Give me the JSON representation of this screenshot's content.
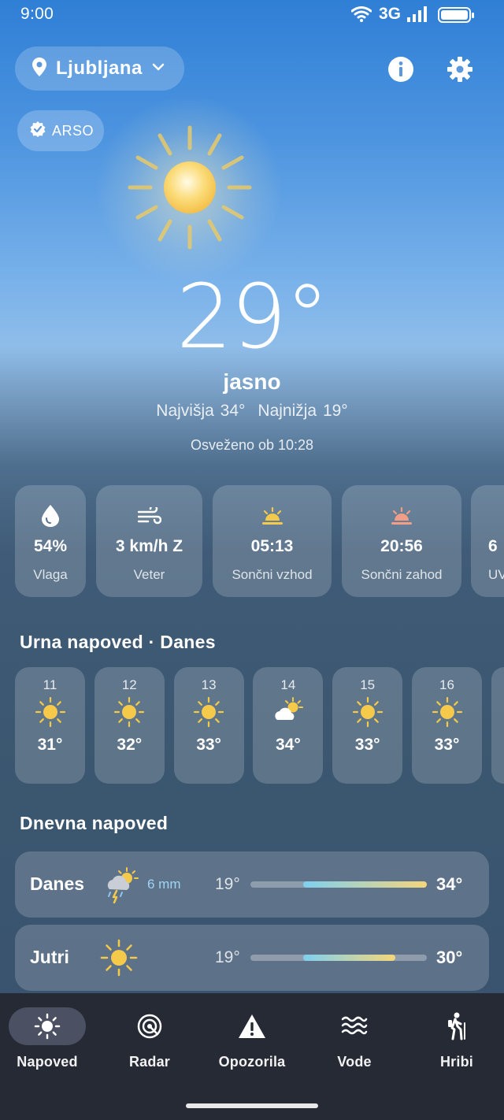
{
  "status_bar": {
    "time": "9:00",
    "network": "3G"
  },
  "header": {
    "location": "Ljubljana",
    "source_badge": "ARSO"
  },
  "current": {
    "temperature": "29°",
    "condition": "jasno",
    "high": "Najvišja 34°",
    "low": "Najnižja 19°",
    "refreshed": "Osveženo ob 10:28"
  },
  "metrics": [
    {
      "value": "54%",
      "label": "Vlaga",
      "icon": "water-drop-icon"
    },
    {
      "value": "3 km/h Z",
      "label": "Veter",
      "icon": "wind-icon"
    },
    {
      "value": "05:13",
      "label": "Sončni vzhod",
      "icon": "sunrise-icon"
    },
    {
      "value": "20:56",
      "label": "Sončni zahod",
      "icon": "sunset-icon"
    },
    {
      "value": "6",
      "label": "UV",
      "icon": "uv-icon"
    }
  ],
  "hourly": {
    "title": "Urna napoved · Danes",
    "items": [
      {
        "hour": "11",
        "temp": "31°",
        "icon": "sun-icon"
      },
      {
        "hour": "12",
        "temp": "32°",
        "icon": "sun-icon"
      },
      {
        "hour": "13",
        "temp": "33°",
        "icon": "sun-icon"
      },
      {
        "hour": "14",
        "temp": "34°",
        "icon": "partly-cloudy-icon"
      },
      {
        "hour": "15",
        "temp": "33°",
        "icon": "sun-icon"
      },
      {
        "hour": "16",
        "temp": "33°",
        "icon": "sun-icon"
      }
    ]
  },
  "daily": {
    "title": "Dnevna napoved",
    "items": [
      {
        "day": "Danes",
        "precip": "6 mm",
        "low": "19°",
        "high": "34°",
        "range": [
          0.3,
          1.0
        ],
        "icon": "thunderstorm-sun-icon"
      },
      {
        "day": "Jutri",
        "precip": "",
        "low": "19°",
        "high": "30°",
        "range": [
          0.3,
          0.82
        ],
        "icon": "sun-icon"
      }
    ]
  },
  "nav": [
    {
      "label": "Napoved",
      "icon": "sun-icon",
      "active": true
    },
    {
      "label": "Radar",
      "icon": "radar-icon",
      "active": false
    },
    {
      "label": "Opozorila",
      "icon": "warning-icon",
      "active": false
    },
    {
      "label": "Vode",
      "icon": "waves-icon",
      "active": false
    },
    {
      "label": "Hribi",
      "icon": "hiking-icon",
      "active": false
    }
  ],
  "colors": {
    "sun": "#f7c948",
    "range_cold": "#7fd0f0",
    "range_warm": "#f5d67a",
    "nav_bg": "#262a35",
    "nav_active": "#4b5062"
  }
}
